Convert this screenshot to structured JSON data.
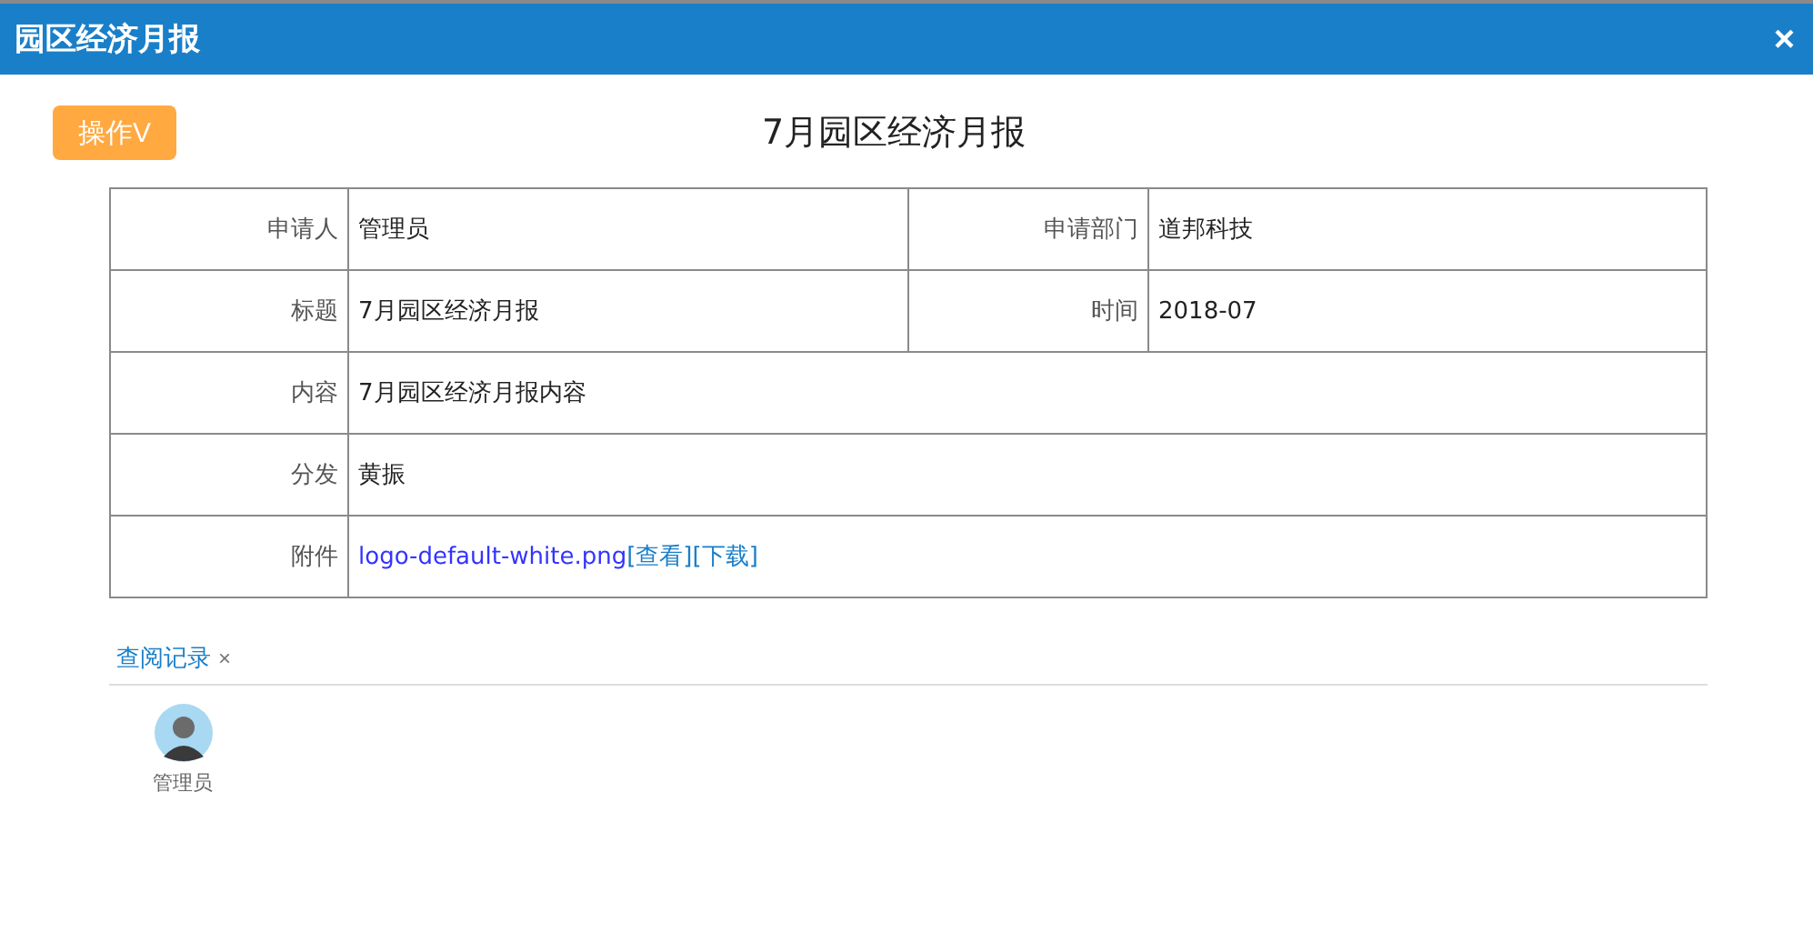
{
  "window": {
    "title": "园区经济月报",
    "close": "×"
  },
  "action_button": "操作V",
  "heading": "7月园区经济月报",
  "rows": [
    {
      "cells": [
        {
          "label": "申请人",
          "kind": "text",
          "value": "管理员"
        },
        {
          "label": "申请部门",
          "kind": "text",
          "value": "道邦科技"
        }
      ]
    },
    {
      "cells": [
        {
          "label": "标题",
          "kind": "text",
          "value": "7月园区经济月报"
        },
        {
          "label": "时间",
          "kind": "text",
          "value": "2018-07"
        }
      ]
    },
    {
      "cells": [
        {
          "label": "内容",
          "kind": "text",
          "value": "7月园区经济月报内容"
        }
      ]
    },
    {
      "cells": [
        {
          "label": "分发",
          "kind": "text",
          "value": "黄振"
        }
      ]
    },
    {
      "cells": [
        {
          "label": "附件",
          "kind": "attachment",
          "file": "logo-default-white.png",
          "links": [
            "[查看]",
            "[下载]"
          ]
        }
      ]
    }
  ],
  "tab": {
    "label": "查阅记录",
    "close": "×"
  },
  "viewers": [
    {
      "name": "管理员"
    }
  ]
}
